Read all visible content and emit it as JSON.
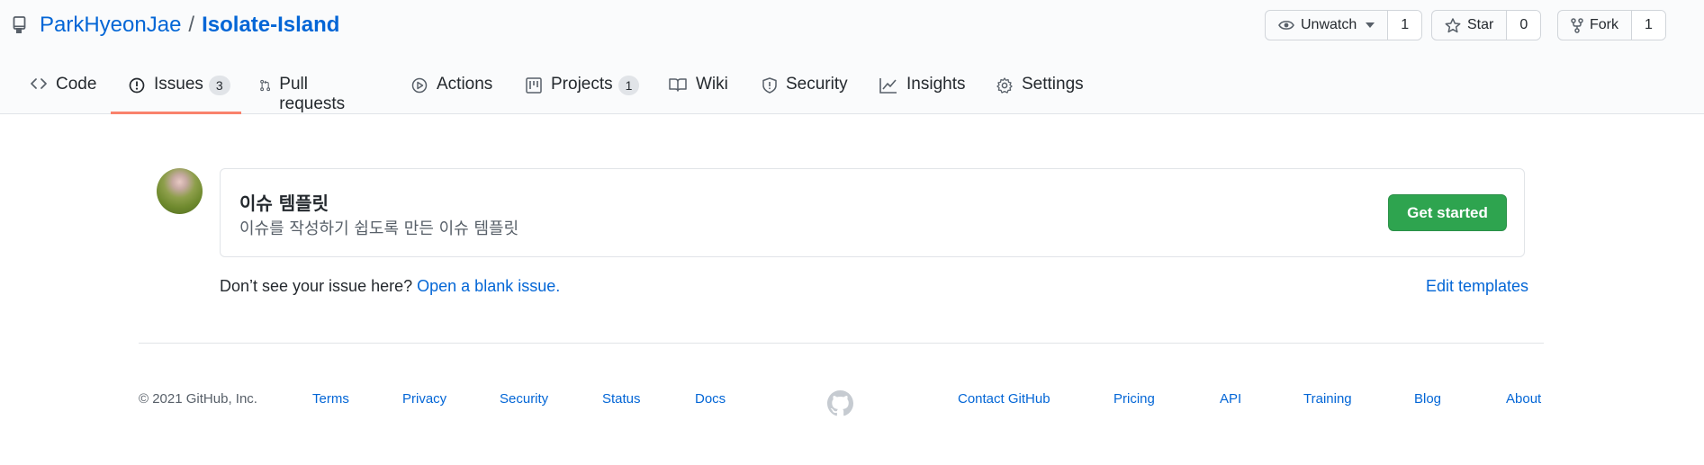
{
  "repo": {
    "owner": "ParkHyeonJae",
    "separator": "/",
    "name": "Isolate-Island"
  },
  "actions": {
    "watch": {
      "label": "Unwatch",
      "count": "1"
    },
    "star": {
      "label": "Star",
      "count": "0"
    },
    "fork": {
      "label": "Fork",
      "count": "1"
    }
  },
  "tabs": [
    {
      "label": "Code",
      "icon": "code-icon"
    },
    {
      "label": "Issues",
      "icon": "issue-icon",
      "counter": "3",
      "selected": true
    },
    {
      "label": "Pull requests",
      "icon": "pull-request-icon"
    },
    {
      "label": "Actions",
      "icon": "play-icon"
    },
    {
      "label": "Projects",
      "icon": "project-icon",
      "counter": "1"
    },
    {
      "label": "Wiki",
      "icon": "book-icon"
    },
    {
      "label": "Security",
      "icon": "shield-icon"
    },
    {
      "label": "Insights",
      "icon": "graph-icon"
    },
    {
      "label": "Settings",
      "icon": "gear-icon"
    }
  ],
  "template": {
    "title": "이슈 템플릿",
    "description": "이슈를 작성하기 쉽도록 만든 이슈 템플릿",
    "button": "Get started"
  },
  "blank_issue": {
    "question": "Don’t see your issue here?",
    "link": "Open a blank issue.",
    "edit_templates": "Edit templates"
  },
  "footer": {
    "copyright": "© 2021 GitHub, Inc.",
    "left_links": [
      "Terms",
      "Privacy",
      "Security",
      "Status",
      "Docs"
    ],
    "right_links": [
      "Contact GitHub",
      "Pricing",
      "API",
      "Training",
      "Blog",
      "About"
    ]
  },
  "colors": {
    "link": "#0366d6",
    "primary_button": "#2ea44f",
    "tab_underline": "#f9826c"
  }
}
